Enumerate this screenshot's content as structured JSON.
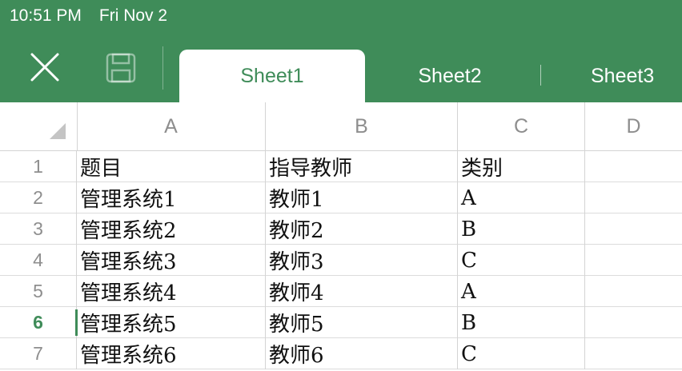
{
  "status_bar": {
    "time": "10:51 PM",
    "date": "Fri Nov 2"
  },
  "toolbar": {
    "close_icon": "close-icon",
    "save_icon": "save-icon"
  },
  "tabs": [
    {
      "label": "Sheet1",
      "active": true
    },
    {
      "label": "Sheet2",
      "active": false
    },
    {
      "label": "Sheet3",
      "active": false
    }
  ],
  "columns": [
    "A",
    "B",
    "C",
    "D"
  ],
  "rows": [
    {
      "num": "1",
      "cells": [
        "题目",
        "指导教师",
        "类别",
        ""
      ]
    },
    {
      "num": "2",
      "cells": [
        "管理系统1",
        "教师1",
        "A",
        ""
      ]
    },
    {
      "num": "3",
      "cells": [
        "管理系统2",
        "教师2",
        "B",
        ""
      ]
    },
    {
      "num": "4",
      "cells": [
        "管理系统3",
        "教师3",
        "C",
        ""
      ]
    },
    {
      "num": "5",
      "cells": [
        "管理系统4",
        "教师4",
        "A",
        ""
      ]
    },
    {
      "num": "6",
      "cells": [
        "管理系统5",
        "教师5",
        "B",
        ""
      ]
    },
    {
      "num": "7",
      "cells": [
        "管理系统6",
        "教师6",
        "C",
        ""
      ]
    }
  ],
  "selected_row": "6",
  "colors": {
    "accent": "#3f8c59",
    "header_text": "#8e8e8e",
    "grid": "#d4d4d4"
  }
}
